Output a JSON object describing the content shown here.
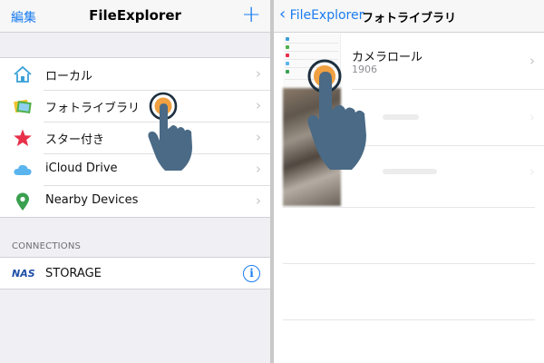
{
  "left": {
    "nav": {
      "edit_label": "編集",
      "title": "FileExplorer",
      "add_icon": "plus-icon"
    },
    "items": [
      {
        "label": "ローカル",
        "icon": "house-icon"
      },
      {
        "label": "フォトライブラリ",
        "icon": "photos-icon"
      },
      {
        "label": "スター付き",
        "icon": "star-icon"
      },
      {
        "label": "iCloud Drive",
        "icon": "cloud-icon"
      },
      {
        "label": "Nearby Devices",
        "icon": "location-pin-icon"
      }
    ],
    "connections": {
      "header": "CONNECTIONS",
      "items": [
        {
          "logo": "NAS",
          "label": "STORAGE",
          "icon": "info-icon"
        }
      ]
    }
  },
  "right": {
    "nav": {
      "back_label": "FileExplorer",
      "title": "フォトライブラリ"
    },
    "albums": [
      {
        "name": "カメラロール",
        "count": "1906"
      }
    ]
  },
  "colors": {
    "accent": "#1a7cf0",
    "hand": "#4a6a86",
    "tap": "#f0a040"
  }
}
